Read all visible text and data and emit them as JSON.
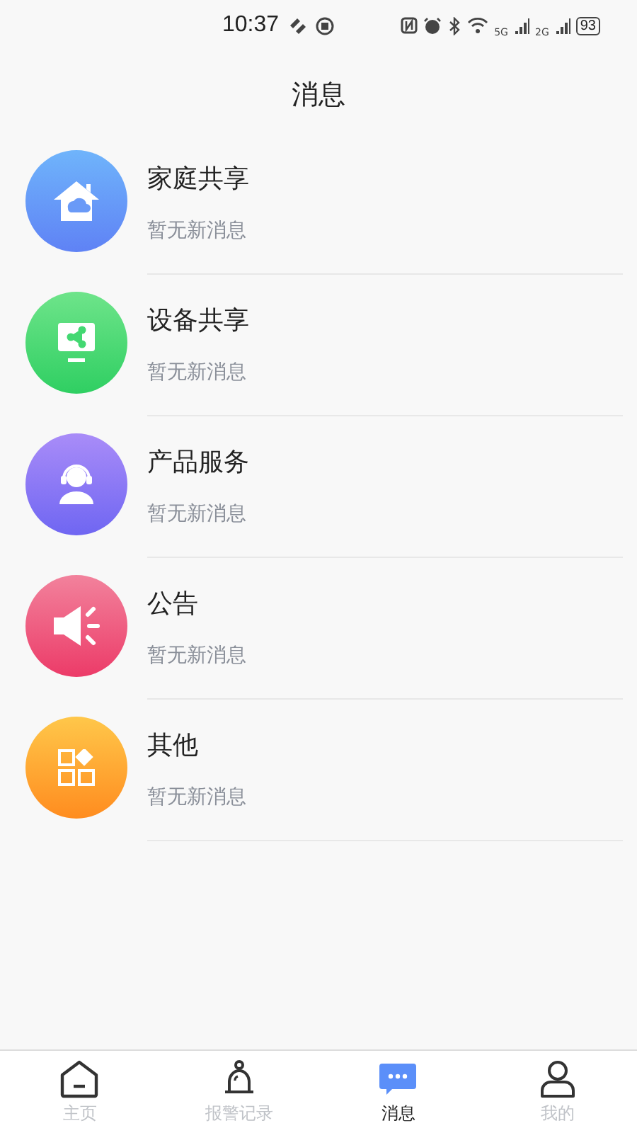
{
  "status_bar": {
    "time": "10:37",
    "network_1": "5G",
    "network_2": "2G",
    "battery": "93"
  },
  "title": "消息",
  "items": [
    {
      "kind": "home",
      "title": "家庭共享",
      "subtitle": "暂无新消息"
    },
    {
      "kind": "device",
      "title": "设备共享",
      "subtitle": "暂无新消息"
    },
    {
      "kind": "service",
      "title": "产品服务",
      "subtitle": "暂无新消息"
    },
    {
      "kind": "notice",
      "title": "公告",
      "subtitle": "暂无新消息"
    },
    {
      "kind": "other",
      "title": "其他",
      "subtitle": "暂无新消息"
    }
  ],
  "tabs": [
    {
      "kind": "home",
      "label": "主页",
      "selected": false
    },
    {
      "kind": "alarm",
      "label": "报警记录",
      "selected": false
    },
    {
      "kind": "message",
      "label": "消息",
      "selected": true
    },
    {
      "kind": "me",
      "label": "我的",
      "selected": false
    }
  ]
}
